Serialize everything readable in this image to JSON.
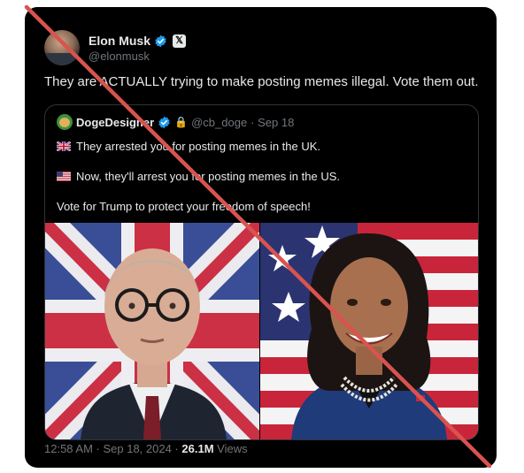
{
  "tweet": {
    "author_name": "Elon Musk",
    "author_handle": "@elonmusk",
    "x_badge": "𝕏",
    "text": "They are ACTUALLY trying to make posting memes illegal. Vote them out.",
    "timestamp": "12:58 AM · Sep 18, 2024 · ",
    "views_count": "26.1M",
    "views_label": " Views"
  },
  "quote": {
    "author_name": "DogeDesigner",
    "badge_emoji": "🔒",
    "author_handle": "@cb_doge",
    "date": "· Sep 18",
    "line1": "They arrested you for posting memes in the UK.",
    "line2": "Now, they'll arrest you for posting memes in the US.",
    "line3": "Vote for Trump to protect your freedom of speech!"
  },
  "colors": {
    "card_bg": "#000000",
    "text_primary": "#e7e9ea",
    "text_secondary": "#71767b",
    "verified_blue": "#1d9bf0",
    "slash_red": "#d9534f"
  },
  "icons": [
    "verified-icon",
    "x-logo-icon",
    "uk-flag-icon",
    "us-flag-icon"
  ]
}
